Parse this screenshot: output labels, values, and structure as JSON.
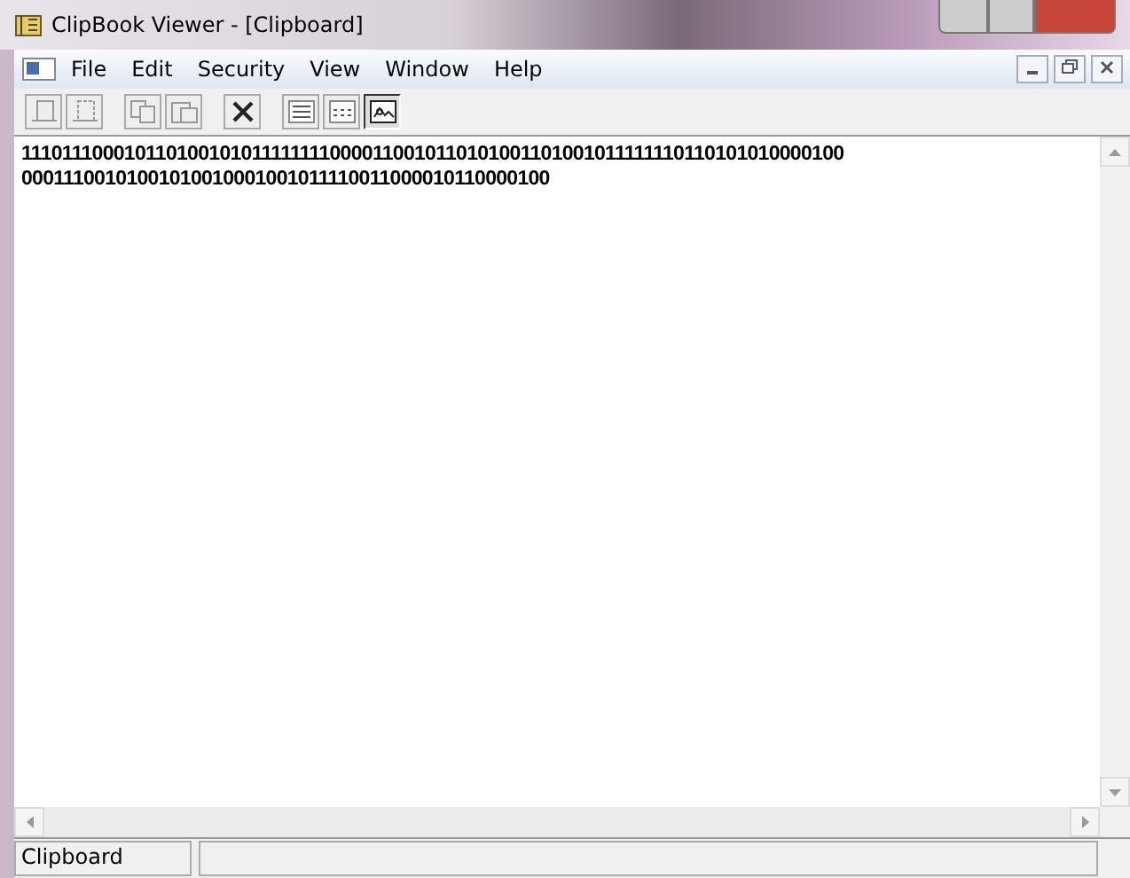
{
  "window": {
    "title": "ClipBook Viewer - [Clipboard]"
  },
  "menu": [
    {
      "label": "File"
    },
    {
      "label": "Edit"
    },
    {
      "label": "Security"
    },
    {
      "label": "View"
    },
    {
      "label": "Window"
    },
    {
      "label": "Help"
    }
  ],
  "toolbar": [
    {
      "kind": "share",
      "disabled": true,
      "pressed": false
    },
    {
      "kind": "unshare",
      "disabled": true,
      "pressed": false
    },
    {
      "kind": "copy",
      "disabled": true,
      "pressed": false
    },
    {
      "kind": "paste",
      "disabled": true,
      "pressed": false
    },
    {
      "kind": "delete",
      "disabled": false,
      "pressed": false
    },
    {
      "kind": "list",
      "disabled": false,
      "pressed": false
    },
    {
      "kind": "thumbnails",
      "disabled": false,
      "pressed": false
    },
    {
      "kind": "fullpage",
      "disabled": false,
      "pressed": true
    }
  ],
  "content": [
    "1110111000101101001010111111110000110010110101001101001011111110110101010000100",
    "00011100101001010010001001011110011000010110000100"
  ],
  "status_bar": {
    "text": "Clipboard"
  }
}
